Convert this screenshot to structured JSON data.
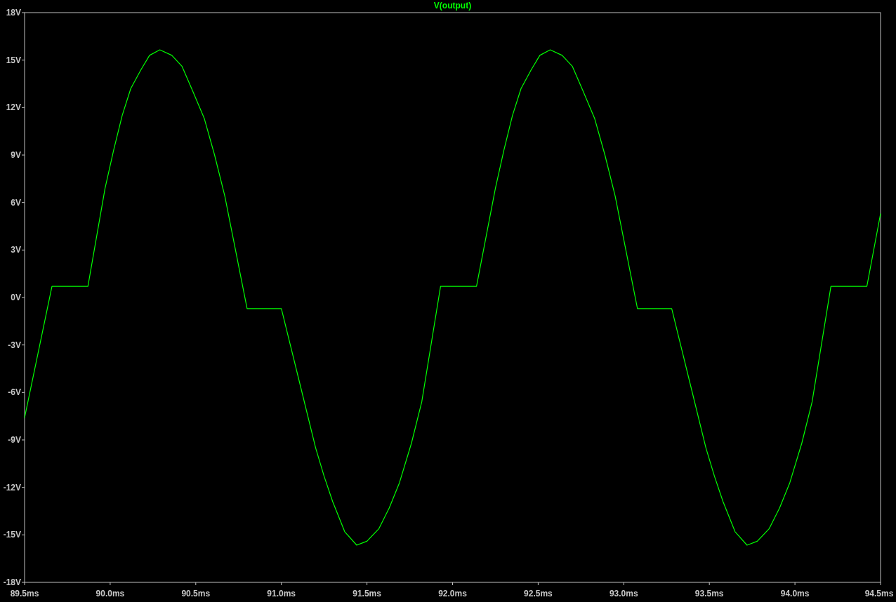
{
  "plot": {
    "chart_data": {
      "type": "line",
      "x": [
        89.5,
        89.66,
        89.87,
        89.97,
        90.02,
        90.07,
        90.12,
        90.18,
        90.23,
        90.29,
        90.36,
        90.42,
        90.48,
        90.55,
        90.61,
        90.67,
        90.8,
        91.0,
        91.1,
        91.2,
        91.25,
        91.3,
        91.37,
        91.44,
        91.5,
        91.57,
        91.63,
        91.69,
        91.76,
        91.82,
        91.93,
        92.14,
        92.25,
        92.3,
        92.35,
        92.4,
        92.46,
        92.51,
        92.57,
        92.64,
        92.7,
        92.76,
        92.83,
        92.89,
        92.95,
        93.08,
        93.28,
        93.38,
        93.48,
        93.53,
        93.58,
        93.65,
        93.72,
        93.78,
        93.85,
        93.91,
        93.97,
        94.04,
        94.1,
        94.21,
        94.42,
        94.5
      ],
      "series": [
        {
          "name": "V(output)",
          "color": "#00ff00",
          "values": [
            -7.6,
            0.7,
            0.7,
            6.9,
            9.3,
            11.5,
            13.2,
            14.4,
            15.3,
            15.65,
            15.3,
            14.6,
            13.1,
            11.3,
            9.0,
            6.4,
            -0.7,
            -0.7,
            -5.1,
            -9.5,
            -11.3,
            -12.9,
            -14.8,
            -15.65,
            -15.4,
            -14.6,
            -13.3,
            -11.7,
            -9.2,
            -6.6,
            0.7,
            0.7,
            6.9,
            9.3,
            11.5,
            13.2,
            14.4,
            15.3,
            15.65,
            15.3,
            14.6,
            13.1,
            11.3,
            9.0,
            6.4,
            -0.7,
            -0.7,
            -5.1,
            -9.5,
            -11.3,
            -12.9,
            -14.8,
            -15.65,
            -15.4,
            -14.6,
            -13.3,
            -11.7,
            -9.2,
            -6.6,
            0.7,
            0.7,
            5.3
          ]
        }
      ],
      "xlim": [
        89.5,
        94.5
      ],
      "ylim": [
        -18,
        18
      ],
      "xticks": [
        {
          "value": 89.5,
          "label": "89.5ms"
        },
        {
          "value": 90.0,
          "label": "90.0ms"
        },
        {
          "value": 90.5,
          "label": "90.5ms"
        },
        {
          "value": 91.0,
          "label": "91.0ms"
        },
        {
          "value": 91.5,
          "label": "91.5ms"
        },
        {
          "value": 92.0,
          "label": "92.0ms"
        },
        {
          "value": 92.5,
          "label": "92.5ms"
        },
        {
          "value": 93.0,
          "label": "93.0ms"
        },
        {
          "value": 93.5,
          "label": "93.5ms"
        },
        {
          "value": 94.0,
          "label": "94.0ms"
        },
        {
          "value": 94.5,
          "label": "94.5ms"
        }
      ],
      "yticks": [
        {
          "value": 18,
          "label": "18V"
        },
        {
          "value": 15,
          "label": "15V"
        },
        {
          "value": 12,
          "label": "12V"
        },
        {
          "value": 9,
          "label": "9V"
        },
        {
          "value": 6,
          "label": "6V"
        },
        {
          "value": 3,
          "label": "3V"
        },
        {
          "value": 0,
          "label": "0V"
        },
        {
          "value": -3,
          "label": "-3V"
        },
        {
          "value": -6,
          "label": "-6V"
        },
        {
          "value": -9,
          "label": "-9V"
        },
        {
          "value": -12,
          "label": "-12V"
        },
        {
          "value": -15,
          "label": "-15V"
        },
        {
          "value": -18,
          "label": "-18V"
        }
      ]
    }
  }
}
